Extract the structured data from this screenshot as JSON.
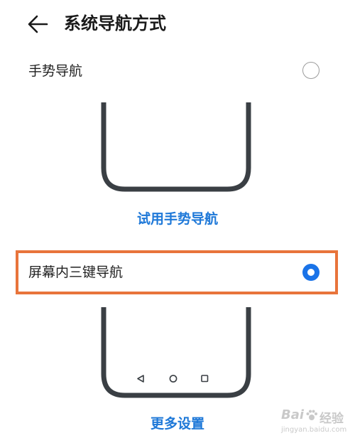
{
  "header": {
    "title": "系统导航方式"
  },
  "options": [
    {
      "label": "手势导航",
      "selected": false
    },
    {
      "label": "屏幕内三键导航",
      "selected": true
    }
  ],
  "links": {
    "try_gesture": "试用手势导航",
    "more_settings": "更多设置"
  },
  "icons": {
    "back": "arrow-left-icon",
    "nav_back": "triangle-back-icon",
    "nav_home": "circle-home-icon",
    "nav_recent": "square-recent-icon"
  },
  "colors": {
    "accent": "#1a73e8",
    "link": "#1e78d8",
    "highlight": "#e8743b",
    "phone_frame": "#3a3f44"
  },
  "watermark": {
    "brand": "Bai",
    "brand2": "经验",
    "url": "jingyan.baidu.com"
  }
}
